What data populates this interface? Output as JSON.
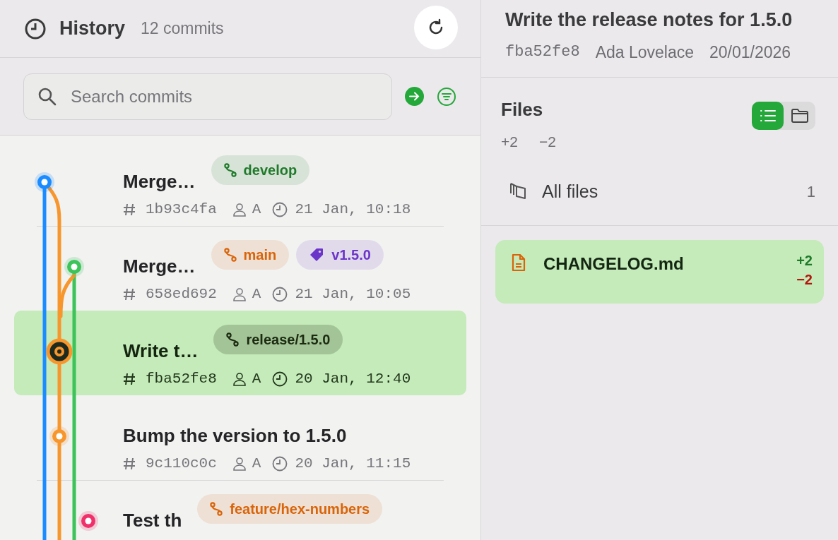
{
  "history": {
    "title": "History",
    "count": "12 commits"
  },
  "search": {
    "placeholder": "Search commits"
  },
  "commits": [
    {
      "title": "Merge…",
      "refs": [
        {
          "kind": "branch",
          "label": "develop",
          "color": "#1f7a2a"
        }
      ],
      "hash": "1b93c4fa",
      "author": "A",
      "time": "21 Jan, 10:18",
      "selected": false,
      "color": "#1a8cff"
    },
    {
      "title": "Merge…",
      "refs": [
        {
          "kind": "branch",
          "label": "main",
          "color": "#d9640a"
        },
        {
          "kind": "tag",
          "label": "v1.5.0",
          "color": "#6b35c9"
        }
      ],
      "hash": "658ed692",
      "author": "A",
      "time": "21 Jan, 10:05",
      "selected": false,
      "color": "#3cc35a"
    },
    {
      "title": "Write t…",
      "refs": [
        {
          "kind": "branch",
          "label": "release/1.5.0",
          "color": "#1c2a10"
        }
      ],
      "hash": "fba52fe8",
      "author": "A",
      "time": "20 Jan, 12:40",
      "selected": true,
      "color": "#f7962d"
    },
    {
      "title": "Bump the version to 1.5.0",
      "hash": "9c110c0c",
      "author": "A",
      "time": "20 Jan, 11:15",
      "selected": false,
      "color": "#f7962d"
    },
    {
      "title": "Test th",
      "refs": [
        {
          "kind": "branch",
          "label": "feature/hex-numbers",
          "color": "#d9640a"
        }
      ],
      "selected": false,
      "color": "#f0306a"
    }
  ],
  "detail": {
    "title": "Write the release notes for 1.5.0",
    "hash": "fba52fe8",
    "author": "Ada Lovelace",
    "date": "20/01/2026"
  },
  "files": {
    "title": "Files",
    "added": "+2",
    "removed": "−2",
    "views": [
      {
        "kind": "list",
        "selected": true
      },
      {
        "kind": "tree",
        "selected": false
      }
    ],
    "all_files": {
      "label": "All files",
      "count": "1"
    },
    "items": [
      {
        "name": "CHANGELOG.md",
        "added": "+2",
        "removed": "−2",
        "selected": true
      }
    ]
  }
}
